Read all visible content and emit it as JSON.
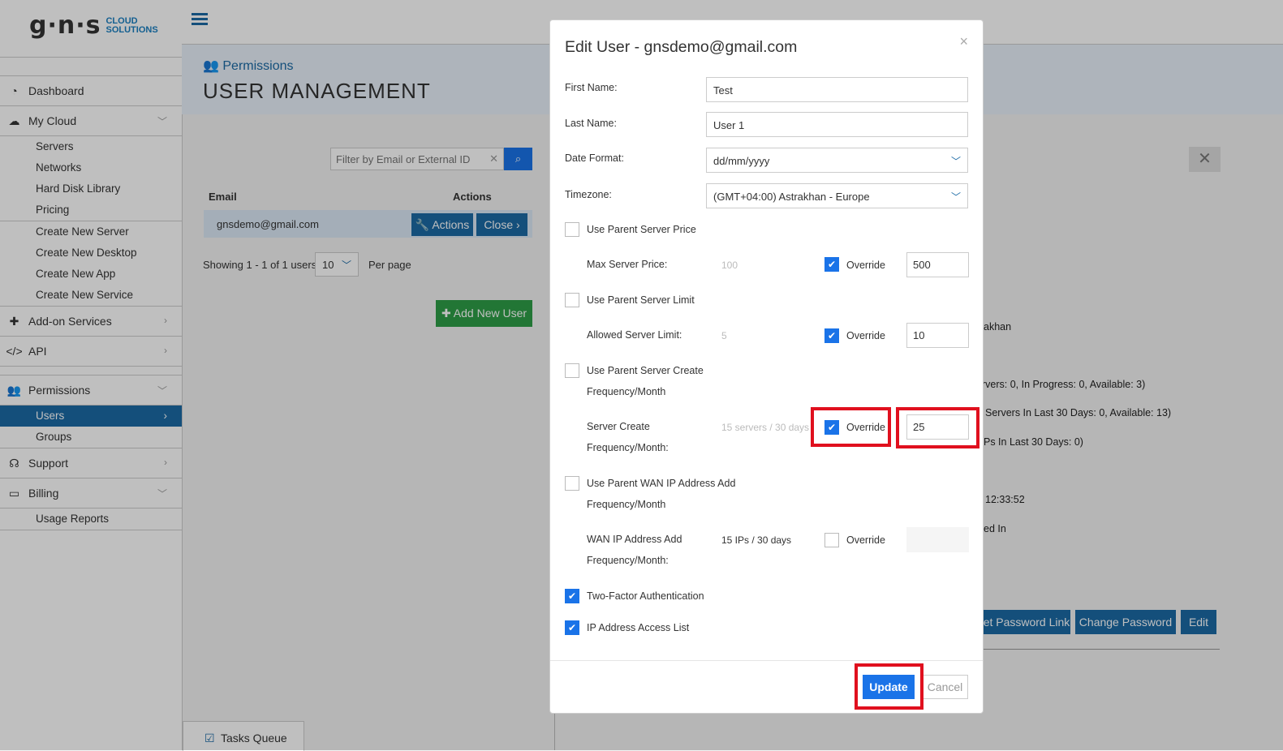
{
  "brand": {
    "logo_text": "g·n·s",
    "logo_sub_line1": "CLOUD",
    "logo_sub_line2": "SOLUTIONS"
  },
  "sidebar": {
    "dashboard": "Dashboard",
    "my_cloud": "My Cloud",
    "my_cloud_sub1": [
      "Servers",
      "Networks",
      "Hard Disk Library",
      "Pricing"
    ],
    "my_cloud_sub2": [
      "Create New Server",
      "Create New Desktop",
      "Create New App",
      "Create New Service"
    ],
    "addon": "Add-on Services",
    "api": "API",
    "permissions": "Permissions",
    "perm_users": "Users",
    "perm_groups": "Groups",
    "support": "Support",
    "billing": "Billing",
    "billing_sub": "Usage Reports"
  },
  "header": {
    "crumb": "Permissions",
    "title": "USER MANAGEMENT"
  },
  "user_list": {
    "filter_placeholder": "Filter by Email or External ID",
    "col_email": "Email",
    "col_actions": "Actions",
    "row_email": "gnsdemo@gmail.com",
    "actions_btn": "Actions",
    "close_btn": "Close",
    "showing": "Showing 1 - 1 of 1 users,",
    "per_page_value": "10",
    "per_page_label": "Per page",
    "add_user": "Add New User"
  },
  "tasks_queue": "Tasks Queue",
  "right_panel": {
    "t1": "akhan",
    "t2": "rvers: 0, In Progress: 0, Available: 3)",
    "t3": "Servers In Last 30 Days: 0, Available: 13)",
    "t4": "Ps In Last 30 Days: 0)",
    "t5": "12:33:52",
    "t6": "ed In",
    "btn_reset": "et Password Link",
    "btn_change": "Change Password",
    "btn_edit": "Edit"
  },
  "modal": {
    "title": "Edit User - gnsdemo@gmail.com",
    "close": "×",
    "first_name_label": "First Name:",
    "first_name_value": "Test",
    "last_name_label": "Last Name:",
    "last_name_value": "User 1",
    "date_format_label": "Date Format:",
    "date_format_value": "dd/mm/yyyy",
    "timezone_label": "Timezone:",
    "timezone_value": "(GMT+04:00) Astrakhan - Europe",
    "use_parent_price": "Use Parent Server Price",
    "max_price_label": "Max Server Price:",
    "max_price_parent": "100",
    "max_price_override_value": "500",
    "use_parent_limit": "Use Parent Server Limit",
    "allowed_limit_label": "Allowed Server Limit:",
    "allowed_limit_parent": "5",
    "allowed_limit_override_value": "10",
    "use_parent_create_l1": "Use Parent Server Create",
    "use_parent_create_l2": "Frequency/Month",
    "create_freq_l1": "Server Create",
    "create_freq_l2": "Frequency/Month:",
    "create_freq_parent": "15 servers / 30 days",
    "create_freq_override_value": "25",
    "use_parent_wan_l1": "Use Parent WAN IP Address Add",
    "use_parent_wan_l2": "Frequency/Month",
    "wan_l1": "WAN IP Address Add",
    "wan_l2": "Frequency/Month:",
    "wan_parent": "15 IPs / 30 days",
    "override": "Override",
    "two_factor": "Two-Factor Authentication",
    "ip_access": "IP Address Access List",
    "update": "Update",
    "cancel": "Cancel"
  },
  "colors": {
    "accent": "#1a73e8",
    "nav_active": "#1b6aa5",
    "add_green": "#2e9e47",
    "highlight": "#e0101e"
  }
}
